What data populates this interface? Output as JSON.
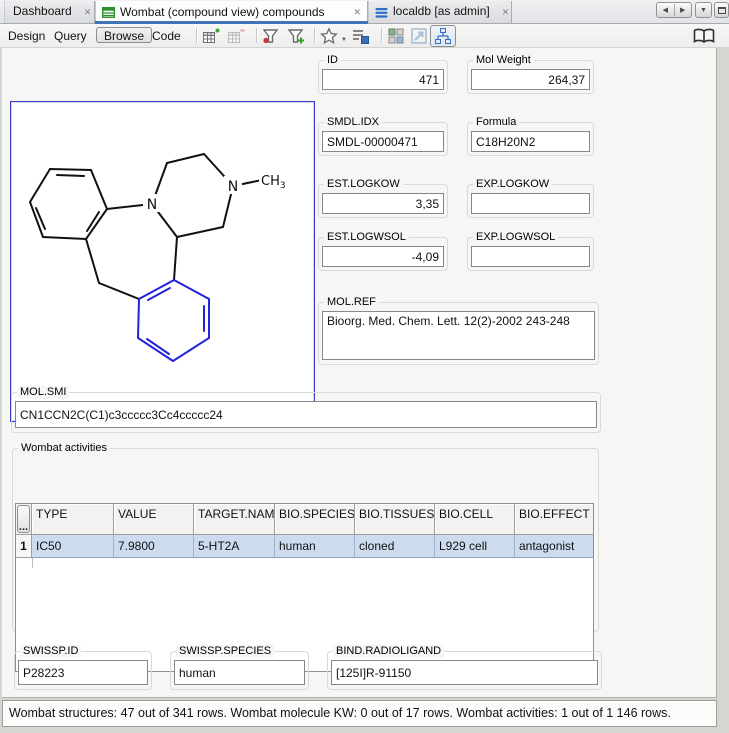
{
  "tabs": [
    {
      "label": "Dashboard"
    },
    {
      "label": "Wombat (compound view) compounds"
    },
    {
      "label": "localdb [as admin]"
    }
  ],
  "icons": {
    "close": "✕",
    "nav_left": "◀",
    "nav_right": "▶",
    "dropdown": "▼",
    "star_dropdown": "▼"
  },
  "toolbar": {
    "design": "Design",
    "query": "Query",
    "browse": "Browse",
    "code": "Code"
  },
  "fields": {
    "id": {
      "label": "ID",
      "value": "471"
    },
    "mol_weight": {
      "label": "Mol Weight",
      "value": "264,37"
    },
    "smdl_idx": {
      "label": "SMDL.IDX",
      "value": "SMDL-00000471"
    },
    "formula": {
      "label": "Formula",
      "value": "C18H20N2"
    },
    "est_logkow": {
      "label": "EST.LOGKOW",
      "value": "3,35"
    },
    "exp_logkow": {
      "label": "EXP.LOGKOW",
      "value": ""
    },
    "est_logwsol": {
      "label": "EST.LOGWSOL",
      "value": "-4,09"
    },
    "exp_logwsol": {
      "label": "EXP.LOGWSOL",
      "value": ""
    },
    "mol_ref": {
      "label": "MOL.REF",
      "value": "Bioorg. Med. Chem. Lett. 12(2)-2002 243-248"
    },
    "mol_smi": {
      "label": "MOL.SMI",
      "value": "CN1CCN2C(C1)c3ccccc3Cc4ccccc24"
    },
    "swissp_id": {
      "label": "SWISSP.ID",
      "value": "P28223"
    },
    "swissp_species": {
      "label": "SWISSP.SPECIES",
      "value": "human"
    },
    "bind_radioligand": {
      "label": "BIND.RADIOLIGAND",
      "value": "[125I]R-91150"
    }
  },
  "activities": {
    "group_label": "Wombat activities",
    "corner_button": "...",
    "columns": [
      "TYPE",
      "VALUE",
      "TARGET.NAME",
      "BIO.SPECIES",
      "BIO.TISSUESOU",
      "BIO.CELL",
      "BIO.EFFECT"
    ],
    "rows": [
      {
        "num": "1",
        "cells": [
          "IC50",
          "7.9800",
          "5-HT2A",
          "human",
          "cloned",
          "L929 cell",
          "antagonist"
        ]
      }
    ]
  },
  "molecule": {
    "n1": "N",
    "n2": "N",
    "methyl": "CH",
    "methyl_subscript": "3",
    "highlight_color": "#2323dd"
  },
  "status_bar": {
    "text": "Wombat structures: 47 out of 341 rows. Wombat molecule KW: 0 out of 17 rows. Wombat activities: 1 out of 1 146 rows."
  }
}
